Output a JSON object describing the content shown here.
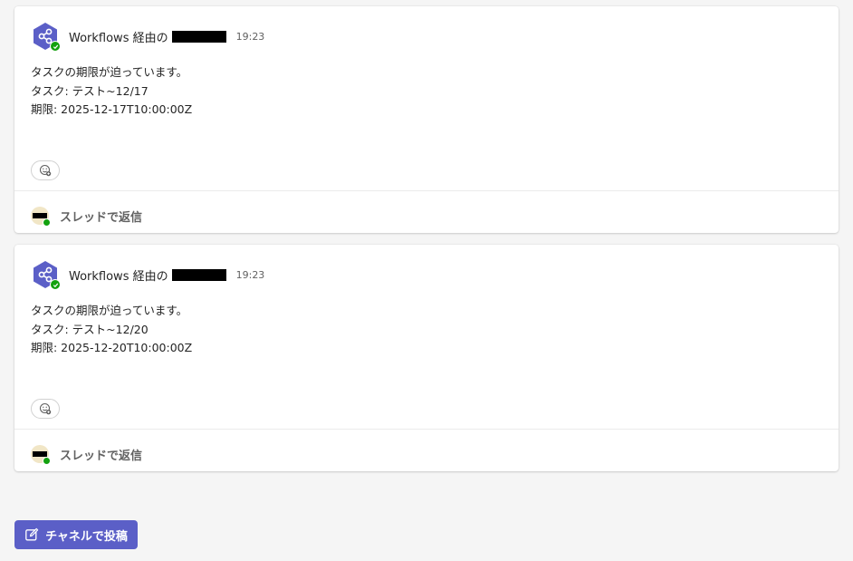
{
  "messages": [
    {
      "sender": "Workflows 経由の",
      "time": "19:23",
      "lines": [
        "タスクの期限が迫っています。",
        "タスク: テスト~12/17",
        "期限: 2025-12-17T10:00:00Z"
      ],
      "reply_label": "スレッドで返信"
    },
    {
      "sender": "Workflows 経由の",
      "time": "19:23",
      "lines": [
        "タスクの期限が迫っています。",
        "タスク: テスト~12/20",
        "期限: 2025-12-20T10:00:00Z"
      ],
      "reply_label": "スレッドで返信"
    }
  ],
  "compose": {
    "post_button_label": "チャネルで投稿"
  },
  "icons": {
    "bot_avatar": "workflows-share-icon",
    "reaction": "emoji-add-icon",
    "post": "compose-edit-icon"
  },
  "colors": {
    "brand": "#5b5fc7",
    "presence_available": "#13a10e",
    "background": "#f5f5f5"
  }
}
